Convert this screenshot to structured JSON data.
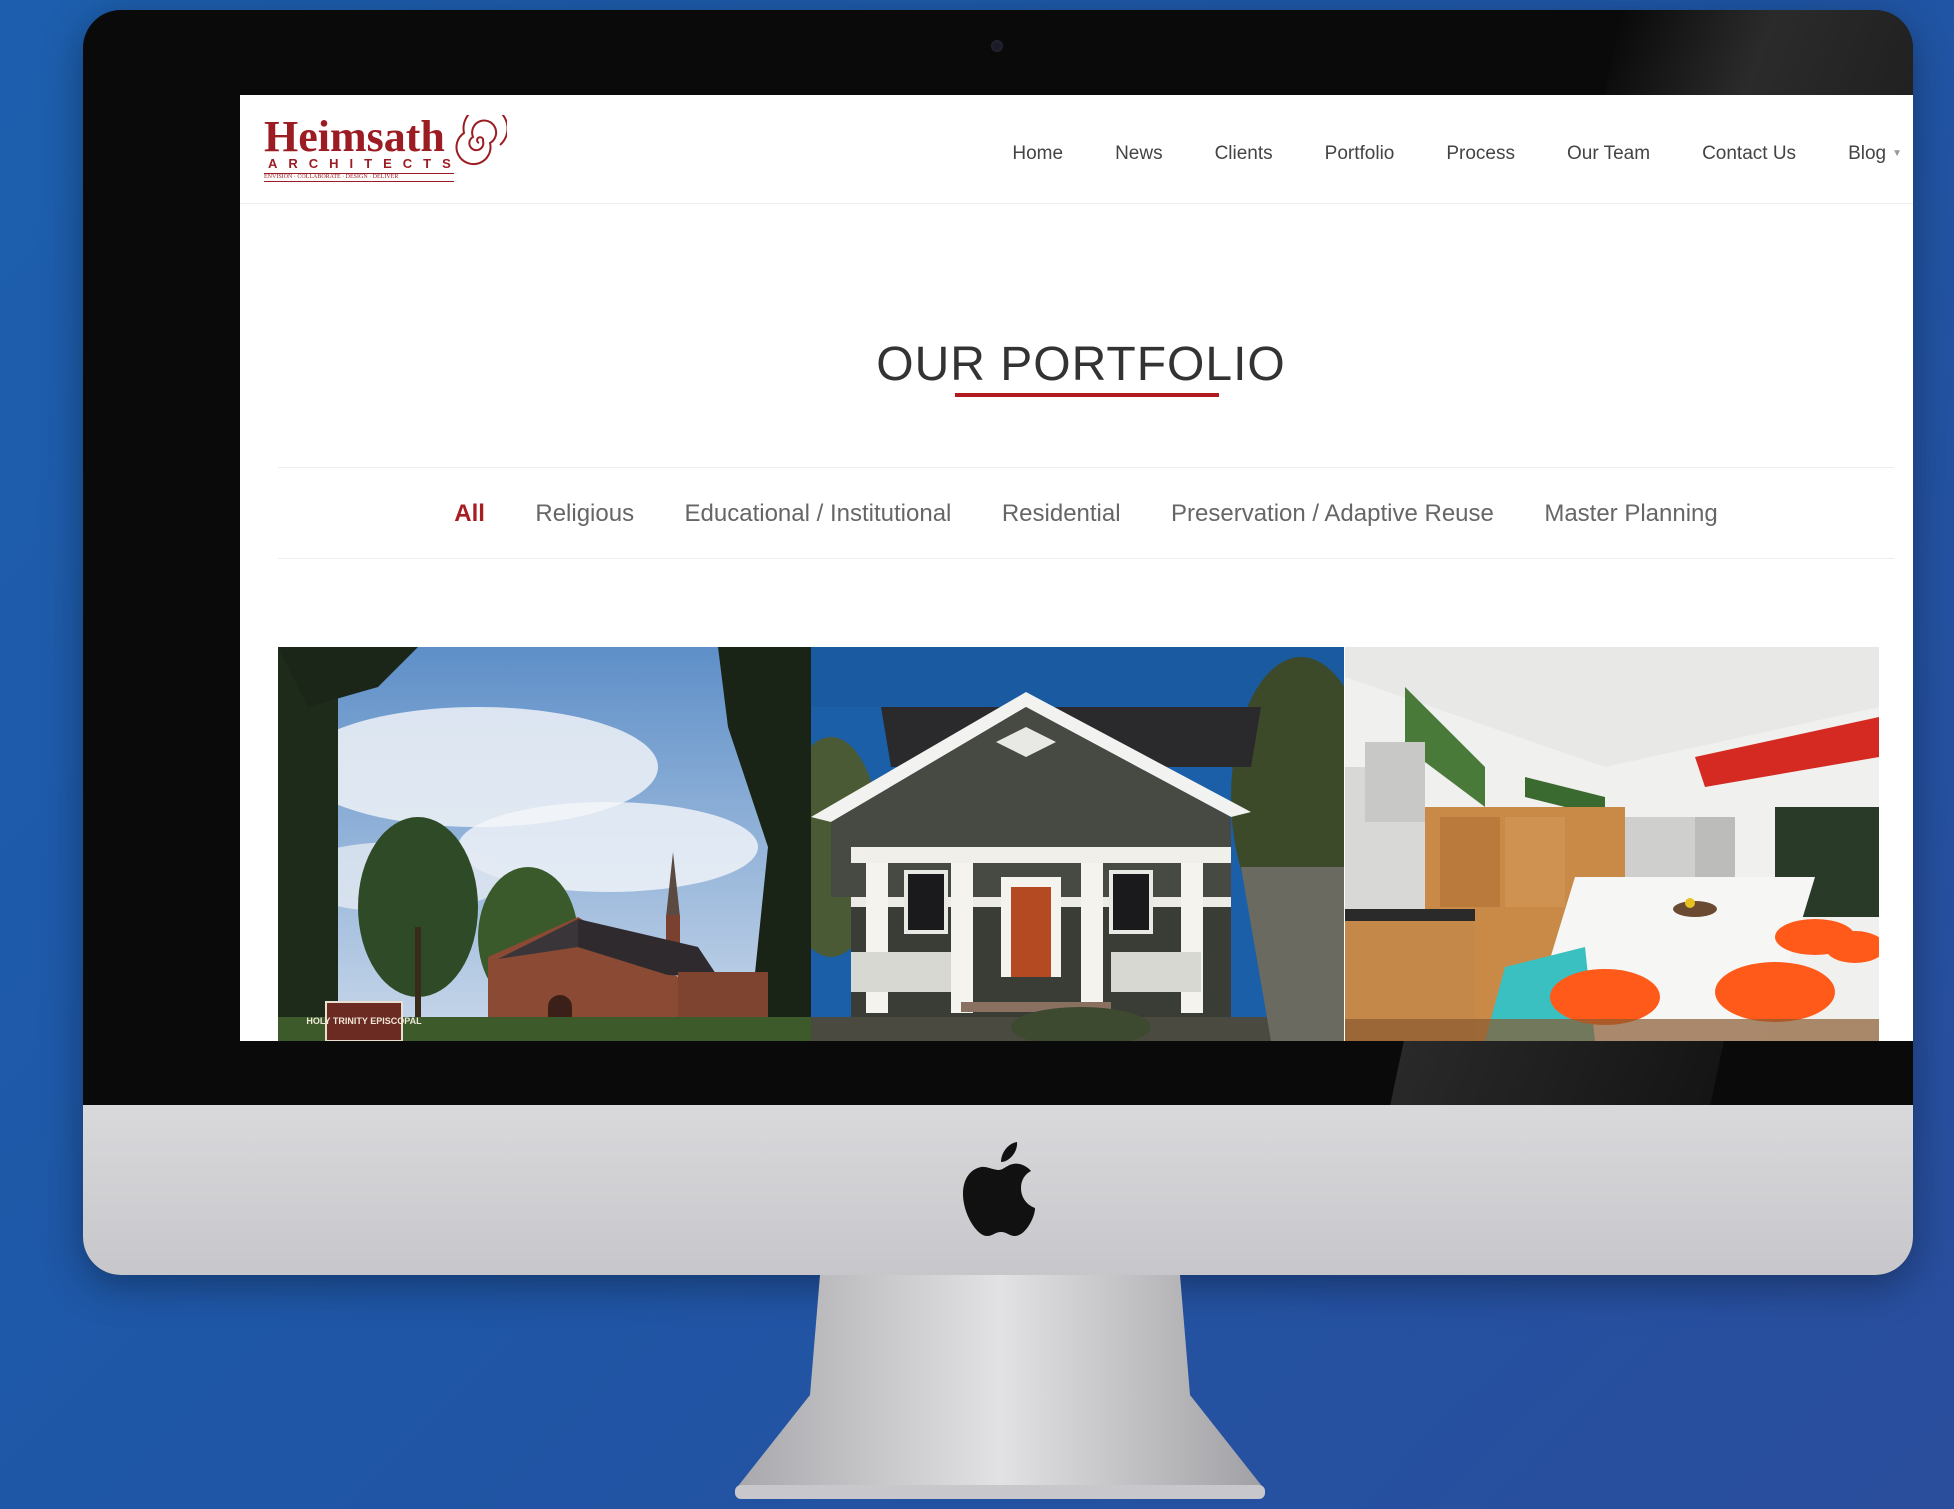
{
  "logo": {
    "name": "Heimsath",
    "subtitle": "ARCHITECTS",
    "tagline": "ENVISION · COLLABORATE · DESIGN · DELIVER"
  },
  "nav": {
    "items": [
      {
        "label": "Home"
      },
      {
        "label": "News"
      },
      {
        "label": "Clients"
      },
      {
        "label": "Portfolio"
      },
      {
        "label": "Process"
      },
      {
        "label": "Our Team"
      },
      {
        "label": "Contact Us"
      },
      {
        "label": "Blog"
      }
    ]
  },
  "page": {
    "title": "OUR PORTFOLIO"
  },
  "filters": {
    "items": [
      {
        "label": "All",
        "active": true
      },
      {
        "label": "Religious"
      },
      {
        "label": "Educational / Institutional"
      },
      {
        "label": "Residential"
      },
      {
        "label": "Preservation / Adaptive Reuse"
      },
      {
        "label": "Master Planning"
      }
    ]
  },
  "gallery": {
    "items": [
      {
        "sign": "HOLY TRINITY EPISCOPAL"
      },
      {},
      {}
    ]
  },
  "colors": {
    "accent": "#a81c22",
    "background": "#1f56a6"
  }
}
